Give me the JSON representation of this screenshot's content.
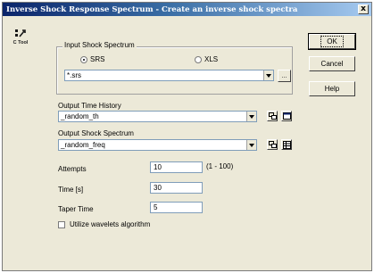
{
  "window": {
    "title": "Inverse Shock Response Spectrum - Create an inverse shock spectra",
    "close_glyph": "x"
  },
  "tool_icon": {
    "label": "C Tool"
  },
  "input_shock": {
    "group_label": "Input Shock Spectrum",
    "radio_srs_label": "SRS",
    "radio_xls_label": "XLS",
    "file_value": "*.srs",
    "browse_label": "..."
  },
  "output_time": {
    "label": "Output Time History",
    "value": "_random_th"
  },
  "output_shock": {
    "label": "Output Shock Spectrum",
    "value": "_random_freq"
  },
  "fields": {
    "attempts_label": "Attempts",
    "attempts_value": "10",
    "attempts_range": "(1 - 100)",
    "time_label": "Time [s]",
    "time_value": "30",
    "taper_label": "Taper Time",
    "taper_value": "5"
  },
  "wavelets": {
    "label": "Utilize wavelets algorithm"
  },
  "buttons": {
    "ok": "OK",
    "cancel": "Cancel",
    "help": "Help"
  }
}
